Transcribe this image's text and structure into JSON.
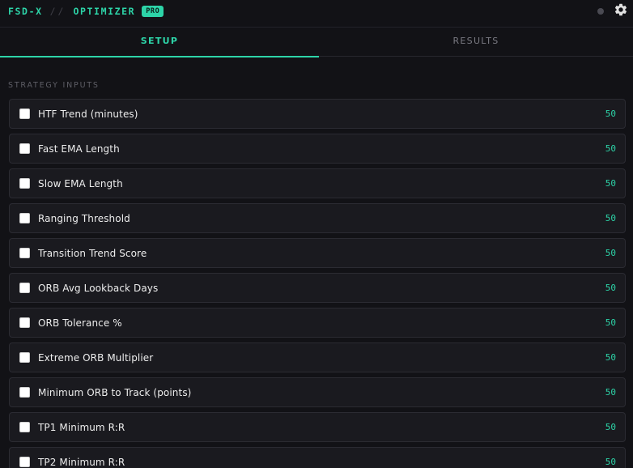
{
  "header": {
    "brand_main": "FSD-X",
    "brand_sep": "//",
    "brand_product": "OPTIMIZER",
    "badge": "PRO",
    "status_icon": "status-dot-icon",
    "settings_icon": "gear-icon"
  },
  "tabs": [
    {
      "label": "SETUP",
      "active": true
    },
    {
      "label": "RESULTS",
      "active": false
    }
  ],
  "section": {
    "label": "STRATEGY INPUTS"
  },
  "inputs": [
    {
      "label": "HTF Trend (minutes)",
      "value": "50",
      "checked": false
    },
    {
      "label": "Fast EMA Length",
      "value": "50",
      "checked": false
    },
    {
      "label": "Slow EMA Length",
      "value": "50",
      "checked": false
    },
    {
      "label": "Ranging Threshold",
      "value": "50",
      "checked": false
    },
    {
      "label": "Transition Trend Score",
      "value": "50",
      "checked": false
    },
    {
      "label": "ORB Avg Lookback Days",
      "value": "50",
      "checked": false
    },
    {
      "label": "ORB Tolerance %",
      "value": "50",
      "checked": false
    },
    {
      "label": "Extreme ORB Multiplier",
      "value": "50",
      "checked": false
    },
    {
      "label": "Minimum ORB to Track (points)",
      "value": "50",
      "checked": false
    },
    {
      "label": "TP1 Minimum R:R",
      "value": "50",
      "checked": false
    },
    {
      "label": "TP2 Minimum R:R",
      "value": "50",
      "checked": false
    }
  ],
  "colors": {
    "accent": "#2dd4a8",
    "background": "#121216",
    "row_background": "#1a1a1f",
    "muted_text": "#7a7a82"
  }
}
